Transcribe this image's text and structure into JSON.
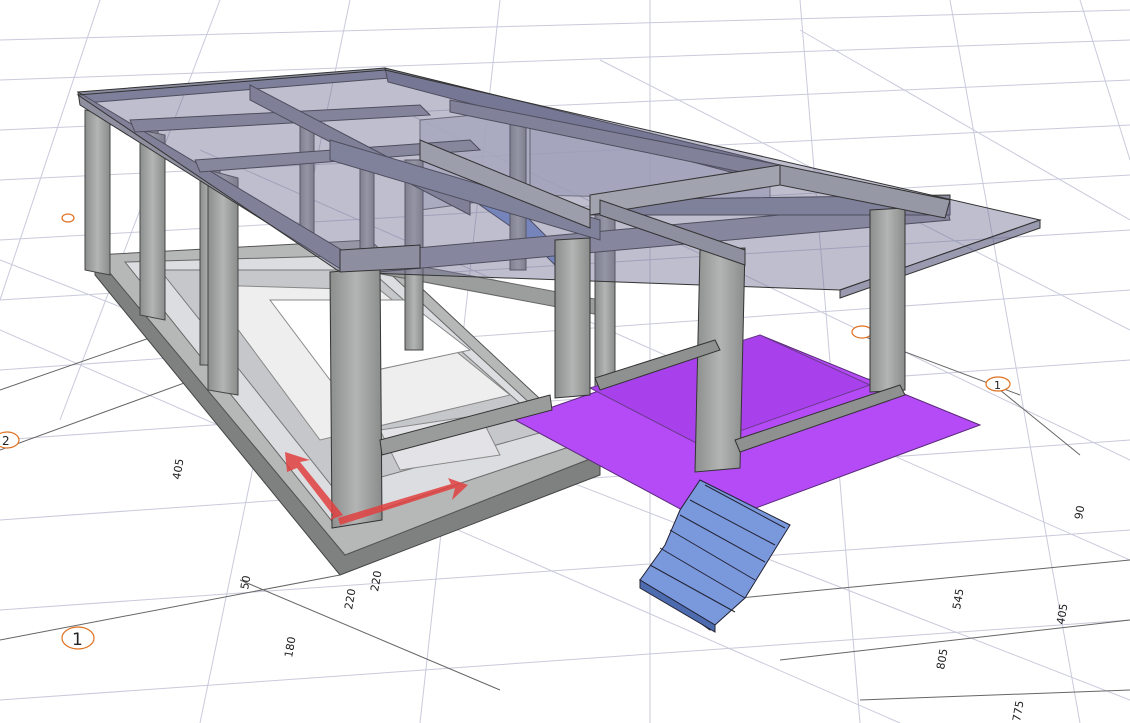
{
  "view": {
    "background": "#ffffff",
    "grid_color": "#c8c8d8",
    "axis_marker_color": "#e07020"
  },
  "axis_markers": [
    {
      "label": "1"
    },
    {
      "label": "2"
    },
    {
      "label": "1"
    }
  ],
  "dimensions": [
    {
      "label": "220"
    },
    {
      "label": "220"
    },
    {
      "label": "50"
    },
    {
      "label": "180"
    },
    {
      "label": "405"
    },
    {
      "label": "545"
    },
    {
      "label": "805"
    },
    {
      "label": "405"
    },
    {
      "label": "775"
    },
    {
      "label": "90"
    }
  ],
  "colors": {
    "concrete": "#a9abaa",
    "concrete_dark": "#7c7e7d",
    "glass_slab": "#6e6e93",
    "platform": "#b44bf6",
    "stairs": "#6f8fd6",
    "ucs_arrow": "#e04040"
  }
}
